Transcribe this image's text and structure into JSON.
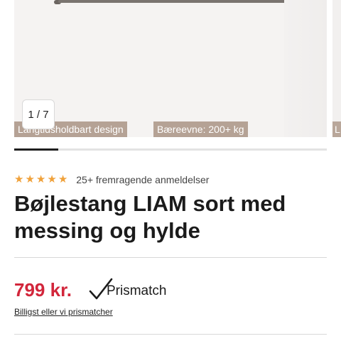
{
  "gallery": {
    "counter": "1 / 7",
    "tags": [
      "Langtidsholdbart design",
      "Bæreevne: 200+ kg"
    ],
    "next_tag": "L",
    "progress": 0.14
  },
  "product": {
    "rating": 5,
    "reviews_text": "25+ fremragende anmeldelser",
    "title": "Bøjlestang LIAM sort med messing og hylde",
    "price": "799 kr.",
    "prismatch_label": "Prismatch",
    "prismatch_link": "Billigst eller vi prismatcher"
  },
  "colors": {
    "star": "#f0a13a",
    "price": "#d2263b",
    "tag_bg": "#b5a295"
  },
  "icons": {
    "star": "star-icon",
    "prismatch": "checkmark-icon"
  }
}
